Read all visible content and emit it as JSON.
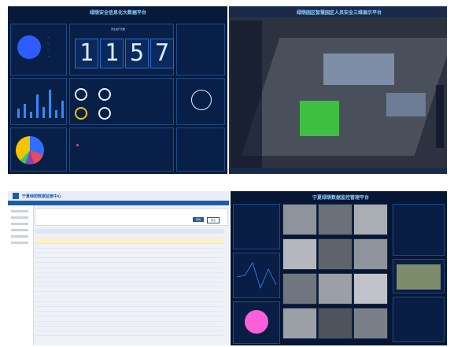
{
  "panel1": {
    "title": "绿荫安全信息化大数据平台",
    "counter_title": "安全运行天数",
    "digits": [
      "1",
      "1",
      "5",
      "7"
    ],
    "accent": "#2f8cff",
    "pie_colors": [
      "#f5c400",
      "#2f6fff",
      "#e84a5f",
      "#8e44ad",
      "#2ecc71"
    ]
  },
  "panel2": {
    "title": "绿荫园区智慧园区人员安全三维展示平台",
    "green": "#3fbf3f"
  },
  "panel3": {
    "title": "宁夏绿荫数据监管中心",
    "search_button": "查询",
    "reset_button": "重置"
  },
  "panel4": {
    "title": "宁夏绿荫数据监控管理平台",
    "donut_color": "#ff5fd8"
  }
}
